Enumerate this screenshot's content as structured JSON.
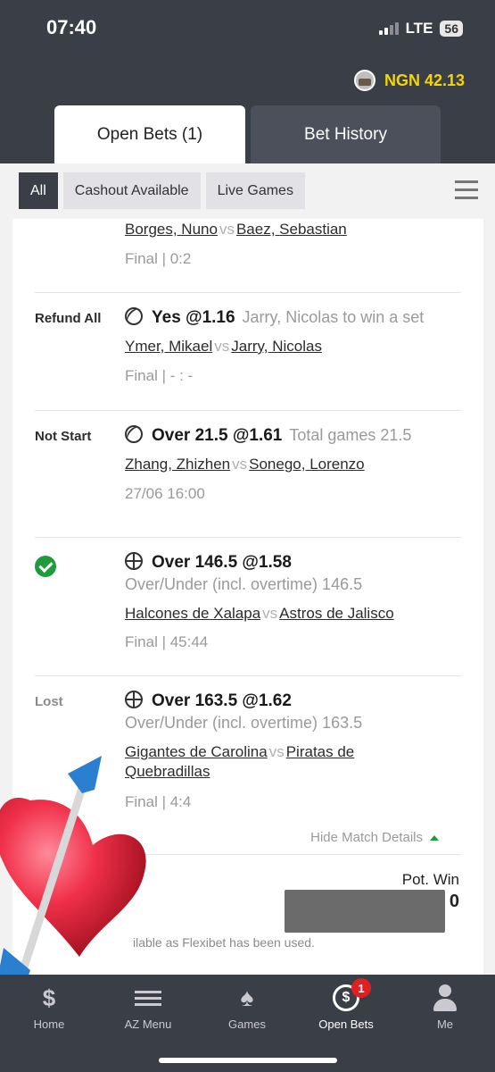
{
  "status_bar": {
    "time": "07:40",
    "network": "LTE",
    "battery": "56"
  },
  "header": {
    "balance": "NGN 42.13"
  },
  "tabs": [
    {
      "label": "Open Bets (1)"
    },
    {
      "label": "Bet History"
    }
  ],
  "filters": [
    {
      "label": "All"
    },
    {
      "label": "Cashout Available"
    },
    {
      "label": "Live Games"
    }
  ],
  "bets": [
    {
      "status": "",
      "pick": "",
      "market": "",
      "home": "Borges, Nuno",
      "vs": "vs",
      "away": "Baez, Sebastian",
      "result": "Final | 0:2"
    },
    {
      "status": "Refund All",
      "sport_icon": "tennis-icon",
      "pick": "Yes @1.16",
      "market": "Jarry, Nicolas to win a set",
      "home": "Ymer, Mikael",
      "vs": "vs",
      "away": "Jarry, Nicolas",
      "result": "Final |  - : -"
    },
    {
      "status": "Not Start",
      "sport_icon": "tennis-icon",
      "pick": "Over 21.5 @1.61",
      "market": "Total games 21.5",
      "home": "Zhang, Zhizhen",
      "vs": "vs",
      "away": "Sonego, Lorenzo",
      "result": "27/06 16:00"
    },
    {
      "status": "won-check",
      "sport_icon": "basketball-icon",
      "pick": "Over 146.5 @1.58",
      "market": "Over/Under (incl. overtime) 146.5",
      "home": "Halcones de Xalapa",
      "vs": "vs",
      "away": "Astros de Jalisco",
      "result": "Final | 45:44"
    },
    {
      "status": "Lost",
      "sport_icon": "basketball-icon",
      "pick": "Over 163.5 @1.62",
      "market": "Over/Under (incl. overtime) 163.5",
      "home": "Gigantes de Carolina",
      "vs": "vs",
      "away_line1": "Piratas de",
      "away_line2": "Quebradillas",
      "result": "Final | 4:4"
    }
  ],
  "details": {
    "hide_label": "Hide Match Details"
  },
  "summary": {
    "pot_win_label": "Pot. Win",
    "pot_win_value_visible": "0",
    "flexi_note": "ilable as Flexibet has been used."
  },
  "bottom_nav": [
    {
      "label": "Home",
      "icon": "home-icon"
    },
    {
      "label": "AZ Menu",
      "icon": "menu-icon"
    },
    {
      "label": "Games",
      "icon": "spade-icon"
    },
    {
      "label": "Open Bets",
      "icon": "open-bets-icon",
      "badge": "1"
    },
    {
      "label": "Me",
      "icon": "person-icon"
    }
  ]
}
